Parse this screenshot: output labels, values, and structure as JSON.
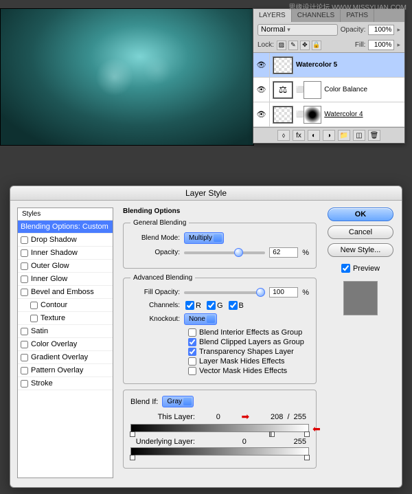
{
  "watermark": "思缘设计论坛 WWW.MISSYUAN.COM",
  "layers_panel": {
    "tabs": [
      "LAYERS",
      "CHANNELS",
      "PATHS"
    ],
    "blend_mode": "Normal",
    "opacity_label": "Opacity:",
    "opacity": "100%",
    "lock_label": "Lock:",
    "fill_label": "Fill:",
    "fill": "100%",
    "layers": [
      {
        "name": "Watercolor 5",
        "selected": true,
        "thumb": "checker"
      },
      {
        "name": "Color Balance",
        "thumb": "adj",
        "mask": "white"
      },
      {
        "name": "Watercolor 4",
        "thumb": "checker",
        "mask": "grad",
        "underline": true
      }
    ]
  },
  "dialog": {
    "title": "Layer Style",
    "styles_header": "Styles",
    "styles": [
      {
        "label": "Blending Options: Custom",
        "active": true
      },
      {
        "label": "Drop Shadow",
        "cb": true
      },
      {
        "label": "Inner Shadow",
        "cb": true
      },
      {
        "label": "Outer Glow",
        "cb": true
      },
      {
        "label": "Inner Glow",
        "cb": true
      },
      {
        "label": "Bevel and Emboss",
        "cb": true
      },
      {
        "label": "Contour",
        "cb": true,
        "indent": true
      },
      {
        "label": "Texture",
        "cb": true,
        "indent": true
      },
      {
        "label": "Satin",
        "cb": true
      },
      {
        "label": "Color Overlay",
        "cb": true
      },
      {
        "label": "Gradient Overlay",
        "cb": true
      },
      {
        "label": "Pattern Overlay",
        "cb": true
      },
      {
        "label": "Stroke",
        "cb": true
      }
    ],
    "options_title": "Blending Options",
    "general": {
      "legend": "General Blending",
      "blend_mode_label": "Blend Mode:",
      "blend_mode": "Multiply",
      "opacity_label": "Opacity:",
      "opacity": "62",
      "pct": "%"
    },
    "advanced": {
      "legend": "Advanced Blending",
      "fill_opacity_label": "Fill Opacity:",
      "fill_opacity": "100",
      "channels_label": "Channels:",
      "channels": [
        "R",
        "G",
        "B"
      ],
      "knockout_label": "Knockout:",
      "knockout": "None",
      "checks": [
        {
          "label": "Blend Interior Effects as Group",
          "on": false
        },
        {
          "label": "Blend Clipped Layers as Group",
          "on": true
        },
        {
          "label": "Transparency Shapes Layer",
          "on": true
        },
        {
          "label": "Layer Mask Hides Effects",
          "on": false
        },
        {
          "label": "Vector Mask Hides Effects",
          "on": false
        }
      ]
    },
    "blendif": {
      "label": "Blend If:",
      "value": "Gray",
      "this_layer_label": "This Layer:",
      "this_layer": "0",
      "this_layer_high": "208",
      "this_layer_max": "255",
      "underlying_label": "Underlying Layer:",
      "underlying_low": "0",
      "underlying_high": "255"
    },
    "buttons": {
      "ok": "OK",
      "cancel": "Cancel",
      "new_style": "New Style...",
      "preview": "Preview"
    }
  }
}
